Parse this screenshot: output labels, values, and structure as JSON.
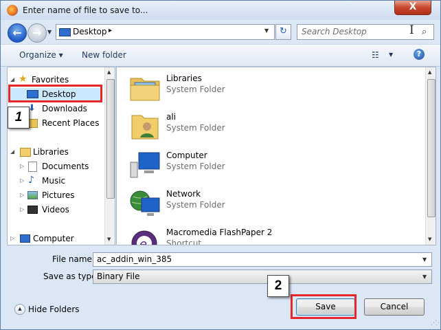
{
  "window": {
    "title": "Enter name of file to save to...",
    "close_glyph": "X"
  },
  "navigation": {
    "back_glyph": "←",
    "forward_glyph": "→",
    "address": {
      "location": "Desktop",
      "separator": "▸"
    },
    "search": {
      "placeholder": "Search Desktop"
    }
  },
  "toolbar": {
    "organize_label": "Organize ▾",
    "new_folder_label": "New folder",
    "help_glyph": "?"
  },
  "sidebar": {
    "favorites": {
      "label": "Favorites",
      "items": [
        {
          "label": "Desktop",
          "icon": "desktop-icon",
          "selected": true
        },
        {
          "label": "Downloads",
          "icon": "downloads-icon"
        },
        {
          "label": "Recent Places",
          "icon": "recent-places-icon"
        }
      ]
    },
    "libraries": {
      "label": "Libraries",
      "items": [
        {
          "label": "Documents",
          "icon": "documents-icon"
        },
        {
          "label": "Music",
          "icon": "music-icon"
        },
        {
          "label": "Pictures",
          "icon": "pictures-icon"
        },
        {
          "label": "Videos",
          "icon": "videos-icon"
        }
      ]
    },
    "computer": {
      "label": "Computer"
    }
  },
  "files": [
    {
      "name": "Libraries",
      "type": "System Folder",
      "icon": "libraries-icon"
    },
    {
      "name": "ali",
      "type": "System Folder",
      "icon": "user-folder-icon"
    },
    {
      "name": "Computer",
      "type": "System Folder",
      "icon": "computer-icon"
    },
    {
      "name": "Network",
      "type": "System Folder",
      "icon": "network-icon"
    },
    {
      "name": "Macromedia FlashPaper 2",
      "type": "Shortcut",
      "icon": "flashpaper-icon"
    }
  ],
  "form": {
    "file_name_label": "File name:",
    "file_name_value": "ac_addin_win_385",
    "save_type_label": "Save as type:",
    "save_type_value": "Binary File"
  },
  "footer": {
    "hide_folders_label": "Hide Folders",
    "save_label": "Save",
    "cancel_label": "Cancel"
  },
  "annotations": {
    "step1": "1",
    "step2": "2"
  },
  "colors": {
    "highlight": "#e8262a",
    "selection": "#cce8ff",
    "accent": "#1e5bc6"
  }
}
